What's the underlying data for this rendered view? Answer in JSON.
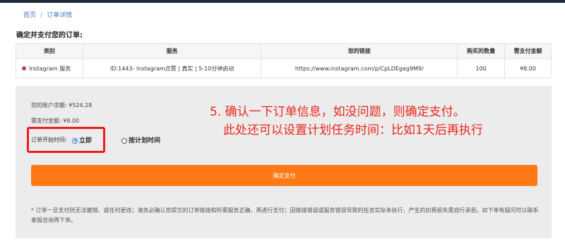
{
  "breadcrumb": {
    "home": "首页",
    "separator": "/",
    "current": "订单详情"
  },
  "section_title": "确定并支付您的订单:",
  "table": {
    "headers": [
      "类别",
      "服务",
      "您的链接",
      "购买的数量",
      "需支付金额"
    ],
    "row": {
      "category": "Instagram 服务",
      "service": "ID:1443- Instagram点赞 | 真实 | 5-10分钟启动",
      "link": "https://www.instagram.com/p/CpLDEgeg9M9/",
      "quantity": "100",
      "price": "¥8.00"
    }
  },
  "account": {
    "balance": "您的账户余额: ¥524.28",
    "amount_due": "需支付金额: ¥8.00"
  },
  "start_time": {
    "label": "订单开始时间:",
    "options": [
      "立即",
      "按计划时间"
    ],
    "selected": "立即"
  },
  "annotation": {
    "line1": "5. 确认一下订单信息，如没问题，则确定支付。",
    "line2": "此处还可以设置计划任务时间：比如1天后再执行"
  },
  "confirm_button": "确定支付",
  "disclaimer": "* 订单一旦支付则无法撤销、或任何更改；请务必确认您提交的订单链接和所需服务正确，再进行支付；因链接错误或服务错误导致的任务实际未执行，产生的扣费损失需自行承担。如下单有疑问可以联系客服咨询再下单。",
  "colors": {
    "accent": "#ff7a16",
    "price": "#e8341c",
    "annotation": "#e8261c",
    "link": "#4a78c2"
  }
}
